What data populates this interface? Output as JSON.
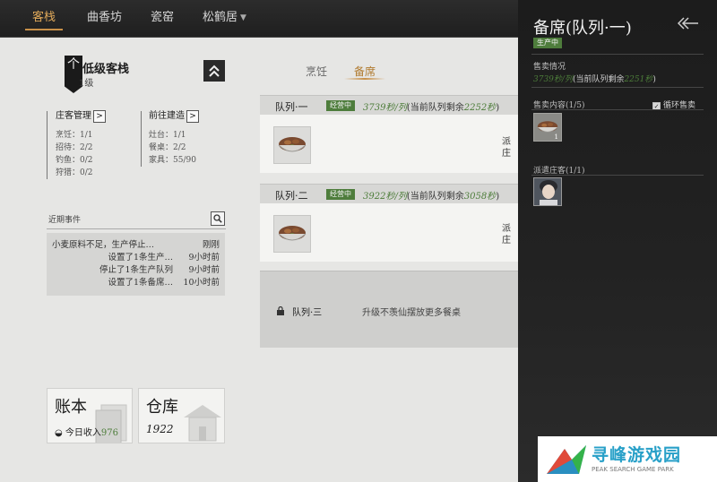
{
  "nav": {
    "tabs": [
      {
        "label": "客栈",
        "active": true
      },
      {
        "label": "曲香坊",
        "active": false
      },
      {
        "label": "瓷窑",
        "active": false
      },
      {
        "label": "松鹤居",
        "active": false
      }
    ],
    "caret_icon": "caret-down-icon"
  },
  "inn": {
    "flag_char": "个",
    "name": "低级客栈",
    "level": "1级",
    "collapse_icon": "double-chevron-up-icon"
  },
  "management": {
    "title": "庄客管理",
    "lines": [
      "烹饪：1/1",
      "招待：2/2",
      "钓鱼：0/2",
      "狩猎：0/2"
    ]
  },
  "build": {
    "title": "前往建造",
    "lines": [
      "灶台：1/1",
      "餐桌：2/2",
      "家具：55/90"
    ]
  },
  "events": {
    "label": "近期事件",
    "search_icon": "magnifier-icon",
    "rows": [
      {
        "text": "小麦原料不足，生产停止…",
        "time": "刚刚"
      },
      {
        "text": "设置了1条生产…",
        "time": "9小时前"
      },
      {
        "text": "停止了1条生产队列",
        "time": "9小时前"
      },
      {
        "text": "设置了1条备席…",
        "time": "10小时前"
      }
    ]
  },
  "ledger": {
    "title": "账本",
    "sub_label": "今日收入",
    "sub_value": "976"
  },
  "warehouse": {
    "title": "仓库",
    "value": "1922"
  },
  "center_tabs": [
    {
      "label": "烹饪",
      "active": false
    },
    {
      "label": "备席",
      "active": true
    }
  ],
  "queues": [
    {
      "name": "队列·一",
      "status": "经营中",
      "rate": "3739秒/列",
      "remain_label": "(当前队列剩余",
      "remain_value": "2252秒",
      "remain_close": ")",
      "cut_text_1": "派",
      "cut_text_2": "庄"
    },
    {
      "name": "队列·二",
      "status": "经营中",
      "rate": "3922秒/列",
      "remain_label": "(当前队列剩余",
      "remain_value": "3058秒",
      "remain_close": ")",
      "cut_text_1": "派",
      "cut_text_2": "庄"
    }
  ],
  "locked_queue": {
    "name": "队列·三",
    "hint": "升级不羡仙摆放更多餐桌",
    "icon": "lock-icon"
  },
  "side_panel": {
    "title": "备席(队列·一)",
    "status": "生产中",
    "back_icon": "back-arrow-icon",
    "sale_label": "售卖情况",
    "sale_rate": "3739秒/列",
    "sale_remain_label": "(当前队列剩余",
    "sale_remain_value": "2251秒",
    "sale_remain_close": ")",
    "content_label": "售卖内容(1/5)",
    "loop_label": "循环售卖",
    "loop_checked": true,
    "food_count": "1",
    "guest_label": "派遣庄客(1/1)"
  },
  "watermark": {
    "text": "寻峰游戏园",
    "sub": "PEAK SEARCH GAME PARK"
  },
  "colors": {
    "accent": "#c89048",
    "status_green": "#4e7d3c",
    "nav_bg": "#232323",
    "panel_bg": "#1f1f1f"
  }
}
